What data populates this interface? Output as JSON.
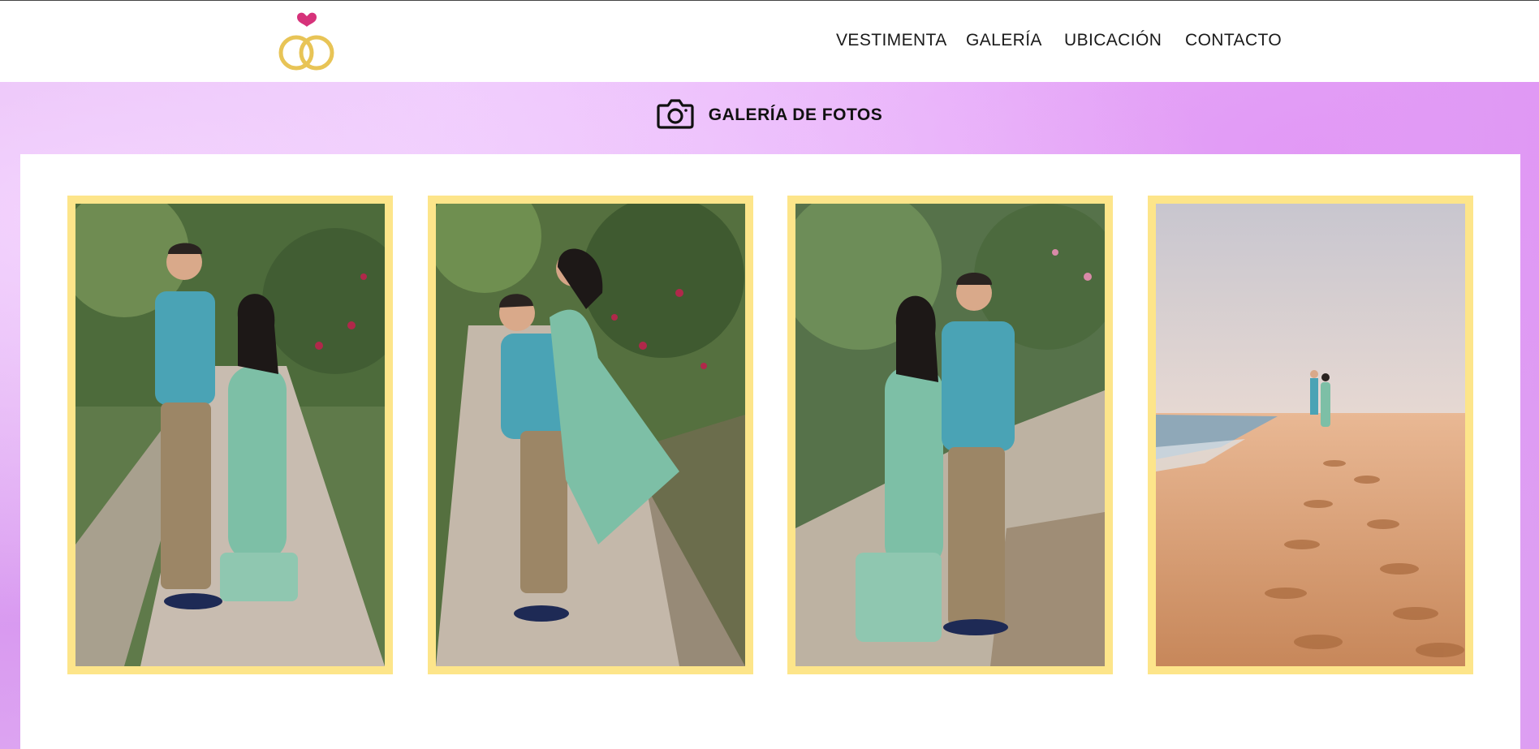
{
  "header": {
    "logo_icon": "wedding-rings-heart-icon",
    "nav": [
      {
        "label": "VESTIMENTA"
      },
      {
        "label": "GALERÍA"
      },
      {
        "label": "UBICACIÓN"
      },
      {
        "label": "CONTACTO"
      }
    ]
  },
  "gallery": {
    "icon": "camera-icon",
    "title": "GALERÍA DE FOTOS",
    "photos": [
      {
        "subject": "couple-standing-dirt-path"
      },
      {
        "subject": "couple-embrace-lift-path"
      },
      {
        "subject": "couple-posing-garden-path"
      },
      {
        "subject": "couple-on-beach-footprints"
      }
    ]
  },
  "colors": {
    "frame": "#fde58a",
    "accent_heart": "#d6327a",
    "rings": "#e8c456",
    "band": "#e6b6f7"
  }
}
